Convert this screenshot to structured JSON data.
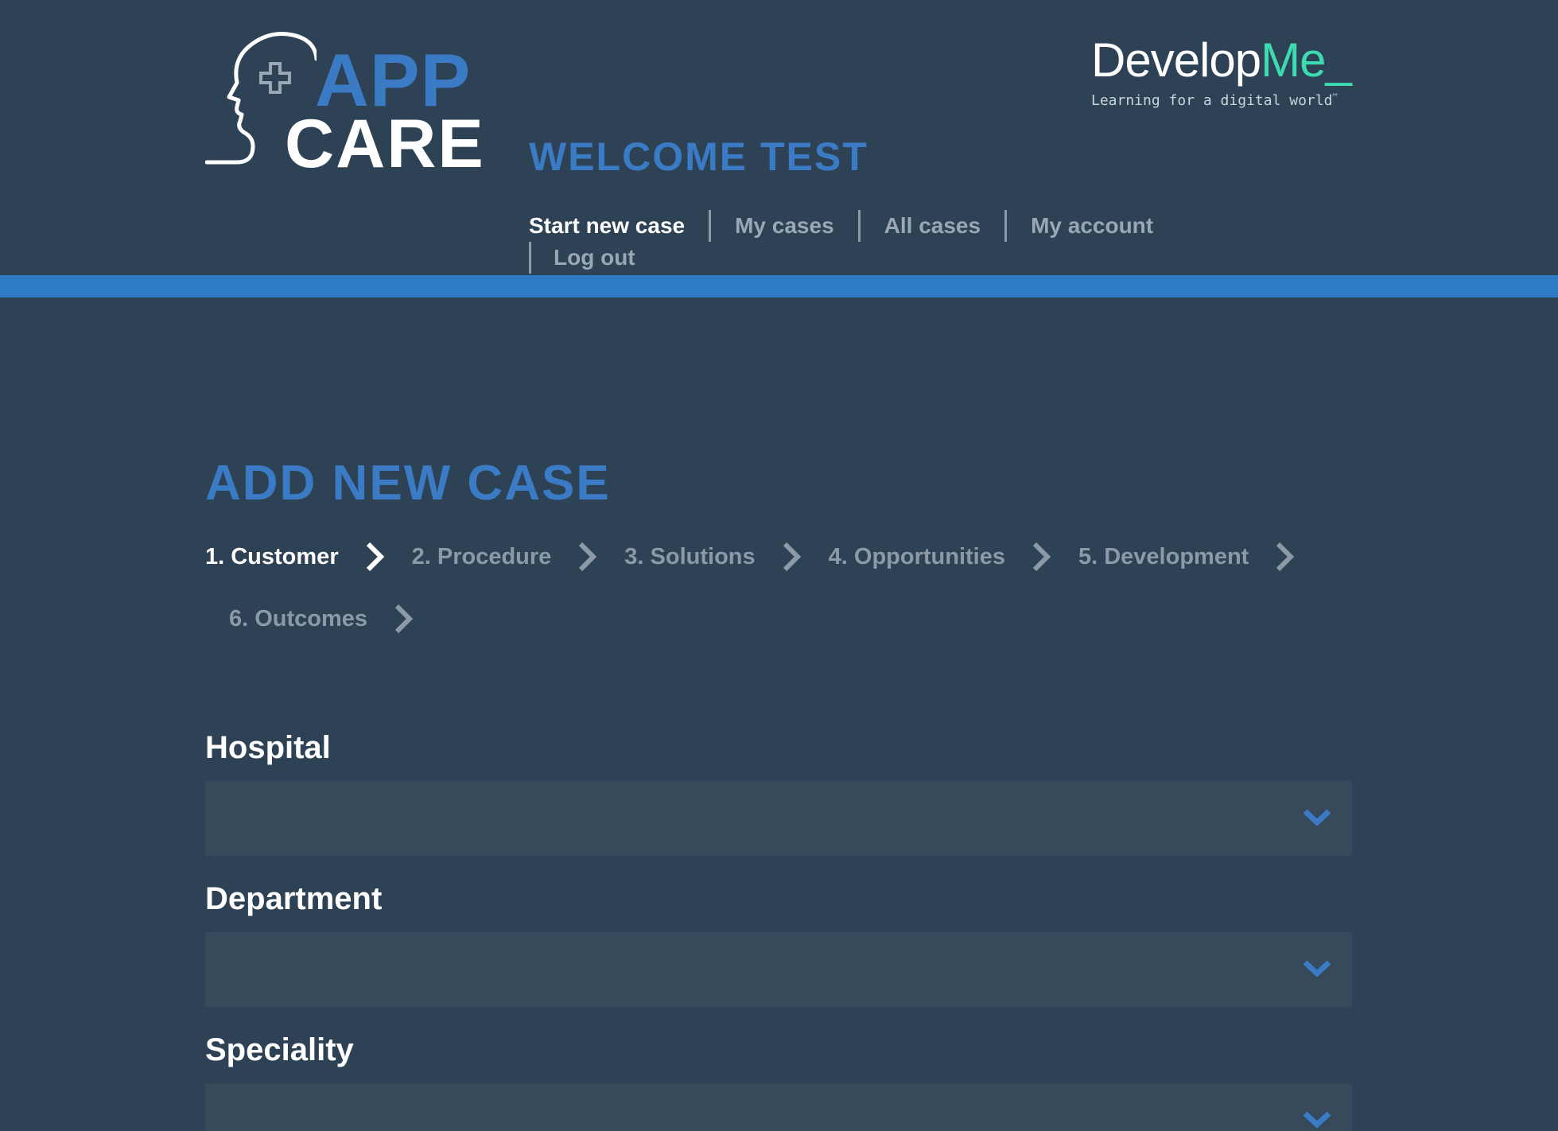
{
  "logo": {
    "app": "APP",
    "care": "CARE"
  },
  "brand": {
    "name_main": "Develop",
    "name_accent": "Me",
    "name_suffix": "_",
    "tagline": "Learning for a digital world",
    "tagline_mark": "™"
  },
  "welcome": "WELCOME TEST",
  "nav": {
    "items": [
      "Start new case",
      "My cases",
      "All cases",
      "My account",
      "Log out"
    ],
    "active_index": 0
  },
  "page_title": "ADD NEW CASE",
  "steps": {
    "items": [
      "1. Customer",
      "2. Procedure",
      "3. Solutions",
      "4. Opportunities",
      "5. Development",
      "6. Outcomes"
    ],
    "active_index": 0
  },
  "form": {
    "fields": [
      {
        "label": "Hospital",
        "value": ""
      },
      {
        "label": "Department",
        "value": ""
      },
      {
        "label": "Speciality",
        "value": ""
      }
    ]
  },
  "colors": {
    "background": "#2e4255",
    "accent_blue": "#3b7ac4",
    "bar_blue": "#2f7ac5",
    "brand_green": "#3ddbb0",
    "select_bg": "#374a5b"
  },
  "icons": [
    "head-cross-icon",
    "chevron-right-icon",
    "chevron-down-icon"
  ]
}
